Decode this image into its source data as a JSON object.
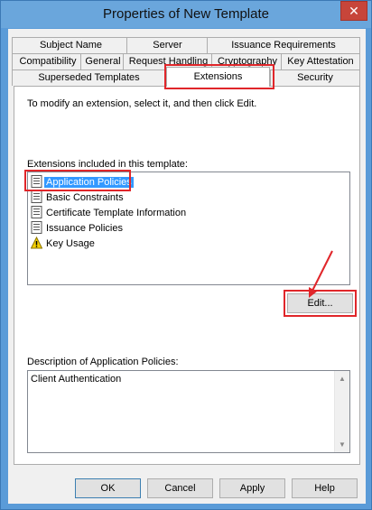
{
  "window": {
    "title": "Properties of New Template",
    "close_label": "✕"
  },
  "tabs": {
    "row1": [
      "Subject Name",
      "Server",
      "Issuance Requirements"
    ],
    "row2": [
      "Compatibility",
      "General",
      "Request Handling",
      "Cryptography",
      "Key Attestation"
    ],
    "row3": [
      "Superseded Templates",
      "Extensions",
      "Security"
    ],
    "active": "Extensions"
  },
  "panel": {
    "instruction": "To modify an extension, select it, and then click Edit.",
    "list_label": "Extensions included in this template:",
    "extensions": [
      {
        "label": "Application Policies",
        "icon": "extension-doc-icon",
        "selected": true
      },
      {
        "label": "Basic Constraints",
        "icon": "extension-doc-icon",
        "selected": false
      },
      {
        "label": "Certificate Template Information",
        "icon": "extension-doc-icon",
        "selected": false
      },
      {
        "label": "Issuance Policies",
        "icon": "extension-doc-icon",
        "selected": false
      },
      {
        "label": "Key Usage",
        "icon": "warning-icon",
        "selected": false
      }
    ],
    "edit_label": "Edit...",
    "description_label": "Description of Application Policies:",
    "description_text": "Client Authentication"
  },
  "footer": {
    "ok": "OK",
    "cancel": "Cancel",
    "apply": "Apply",
    "help": "Help"
  },
  "colors": {
    "annotation": "#e0262a",
    "selection": "#3399ff",
    "titlebar": "#6aa6dc"
  }
}
